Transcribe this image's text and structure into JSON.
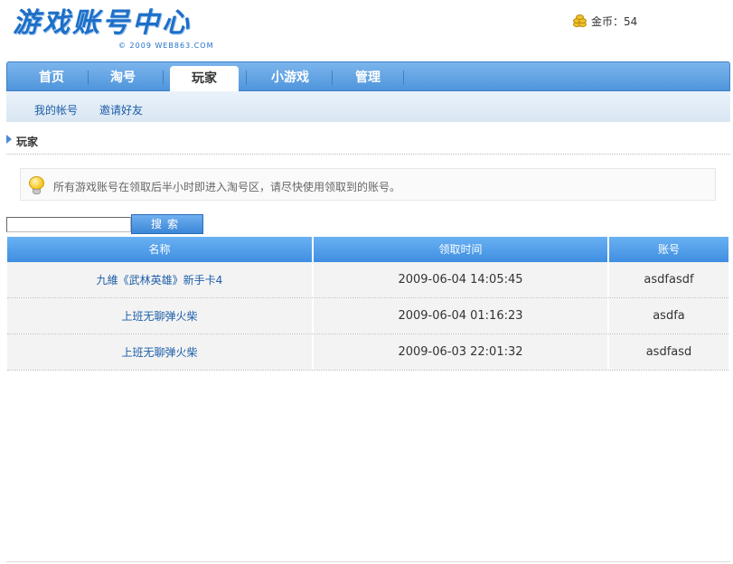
{
  "header": {
    "logo_title": "游戏账号中心",
    "logo_copyright": "© 2009 WEB863.COM",
    "coins_label": "金币：54"
  },
  "nav": {
    "items": [
      {
        "label": "首页",
        "active": false
      },
      {
        "label": "淘号",
        "active": false
      },
      {
        "label": "玩家",
        "active": true
      },
      {
        "label": "小游戏",
        "active": false
      },
      {
        "label": "管理",
        "active": false
      }
    ]
  },
  "subnav": {
    "items": [
      {
        "label": "我的帐号"
      },
      {
        "label": "邀请好友"
      }
    ]
  },
  "section": {
    "title": "玩家"
  },
  "notice": {
    "text": "所有游戏账号在领取后半小时即进入淘号区，请尽快使用领取到的账号。"
  },
  "search": {
    "value": "",
    "button_label": "搜索"
  },
  "table": {
    "headers": [
      "名称",
      "领取时间",
      "账号"
    ],
    "rows": [
      {
        "name": "九維《武林英雄》新手卡4",
        "time": "2009-06-04 14:05:45",
        "account": "asdfasdf"
      },
      {
        "name": "上班无聊弹火柴",
        "time": "2009-06-04 01:16:23",
        "account": "asdfa"
      },
      {
        "name": "上班无聊弹火柴",
        "time": "2009-06-03 22:01:32",
        "account": "asdfasd"
      }
    ]
  },
  "colors": {
    "accent": "#4f95dc",
    "link": "#1c5ea8",
    "header_bg": "#6ab1f3"
  }
}
